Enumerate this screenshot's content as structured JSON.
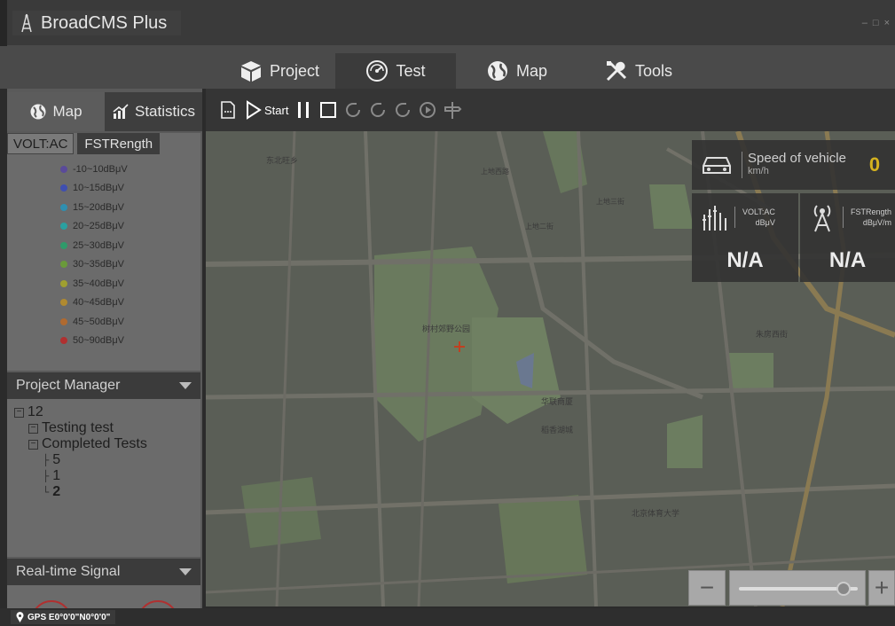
{
  "app": {
    "title": "BroadCMS Plus",
    "controls": [
      "–",
      "□",
      "×"
    ]
  },
  "main_tabs": [
    {
      "label": "Project",
      "icon": "box-icon",
      "active": false
    },
    {
      "label": "Test",
      "icon": "gauge-icon",
      "active": true
    },
    {
      "label": "Map",
      "icon": "globe-icon",
      "active": false
    },
    {
      "label": "Tools",
      "icon": "tools-icon",
      "active": false
    }
  ],
  "sidebar": {
    "tabs": [
      {
        "label": "Map",
        "icon": "globe-icon",
        "active": true
      },
      {
        "label": "Statistics",
        "icon": "chart-icon",
        "active": false
      }
    ],
    "legend_tabs": [
      {
        "label": "VOLT:AC",
        "active": true
      },
      {
        "label": "FSTRength",
        "active": false
      }
    ],
    "legend": [
      {
        "label": "-10~10dBμV",
        "color": "#5a4a9a"
      },
      {
        "label": "10~15dBμV",
        "color": "#3f4fb0"
      },
      {
        "label": "15~20dBμV",
        "color": "#2f8fb0"
      },
      {
        "label": "20~25dBμV",
        "color": "#2aa0a0"
      },
      {
        "label": "25~30dBμV",
        "color": "#2f9a6a"
      },
      {
        "label": "30~35dBμV",
        "color": "#6a9a3a"
      },
      {
        "label": "35~40dBμV",
        "color": "#a0a030"
      },
      {
        "label": "40~45dBμV",
        "color": "#b08a30"
      },
      {
        "label": "45~50dBμV",
        "color": "#b06a30"
      },
      {
        "label": "50~90dBμV",
        "color": "#b03030"
      }
    ],
    "project_manager": {
      "title": "Project Manager",
      "root": "12",
      "testing": "Testing test",
      "completed": "Completed Tests",
      "items": [
        "5",
        "1",
        "2"
      ]
    },
    "realtime": {
      "title": "Real-time Signal"
    }
  },
  "toolbar": {
    "start_label": "Start"
  },
  "map": {
    "labels": [
      "东北旺乡",
      "树村郊野公园",
      "华联商厦",
      "稻香湖城",
      "北京体育大学",
      "朱房西街",
      "上地三街",
      "上地二街",
      "上地西路"
    ]
  },
  "speed": {
    "label": "Speed of vehicle",
    "unit": "km/h",
    "value": "0",
    "value_color": "#d4b21f"
  },
  "meters": [
    {
      "name": "VOLT:AC",
      "unit": "dBμV",
      "value": "N/A",
      "icon": "signal-bars-icon"
    },
    {
      "name": "FSTRength",
      "unit": "dBμV/m",
      "value": "N/A",
      "icon": "antenna-icon"
    }
  ],
  "zoom": {
    "level": 0.88
  },
  "status": {
    "gps": "GPS E0°0'0\"N0°0'0\""
  }
}
